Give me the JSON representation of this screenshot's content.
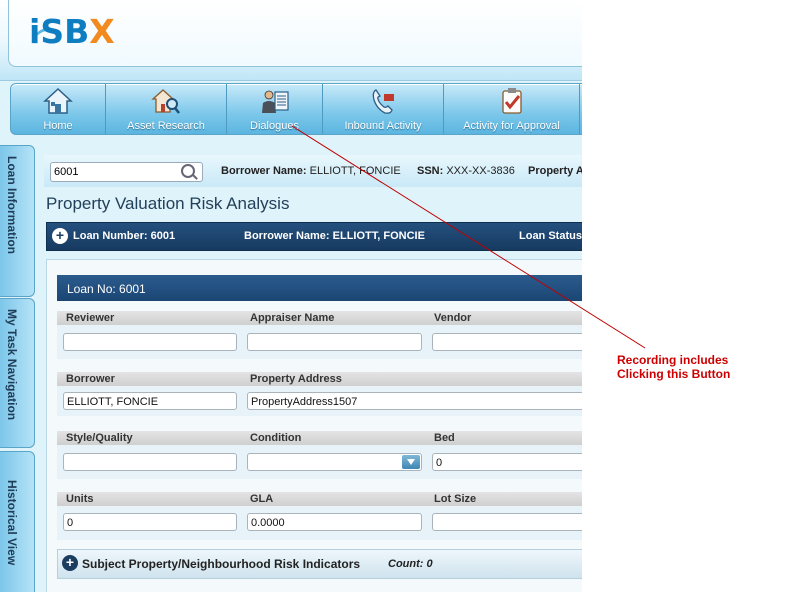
{
  "logo": {
    "part1": "i",
    "part2": "SB",
    "part3": "X"
  },
  "nav": [
    {
      "label": "Home",
      "icon": "home-icon"
    },
    {
      "label": "Asset Research",
      "icon": "house-search-icon"
    },
    {
      "label": "Dialogues",
      "icon": "person-document-icon"
    },
    {
      "label": "Inbound Activity",
      "icon": "phone-icon"
    },
    {
      "label": "Activity for Approval",
      "icon": "clipboard-check-icon"
    }
  ],
  "side_tabs": [
    "Loan Information",
    "My Task Navigation",
    "Historical View"
  ],
  "search": {
    "value": "6001"
  },
  "info_bar": {
    "borrower_label": "Borrower Name:",
    "borrower_value": "ELLIOTT, FONCIE",
    "ssn_label": "SSN:",
    "ssn_value": "XXX-XX-3836",
    "property_label": "Property A"
  },
  "page_title": "Property Valuation Risk Analysis",
  "loan_header": {
    "loan_number": "Loan Number: 6001",
    "borrower": "Borrower Name: ELLIOTT, FONCIE",
    "status": "Loan Status:"
  },
  "panel": {
    "title": "Loan No: 6001",
    "labels": {
      "reviewer": "Reviewer",
      "appraiser": "Appraiser Name",
      "vendor": "Vendor",
      "borrower": "Borrower",
      "address": "Property Address",
      "style": "Style/Quality",
      "condition": "Condition",
      "bed": "Bed",
      "units": "Units",
      "gla": "GLA",
      "lot": "Lot Size"
    },
    "values": {
      "reviewer": "",
      "appraiser": "",
      "vendor": "",
      "borrower": "ELLIOTT, FONCIE",
      "address": "PropertyAddress1507",
      "style": "",
      "condition": "",
      "bed": "0",
      "units": "0",
      "gla": "0.0000",
      "lot": ""
    },
    "subject_title": "Subject Property/Neighbourhood Risk Indicators",
    "subject_count": "Count: 0"
  },
  "annotation": {
    "line1": "Recording includes",
    "line2": "Clicking this Button"
  },
  "colors": {
    "annotation": "#cc0000",
    "header_navy": "#1b4674",
    "logo_orange": "#f28a1f",
    "logo_blue": "#0f7ec0"
  }
}
